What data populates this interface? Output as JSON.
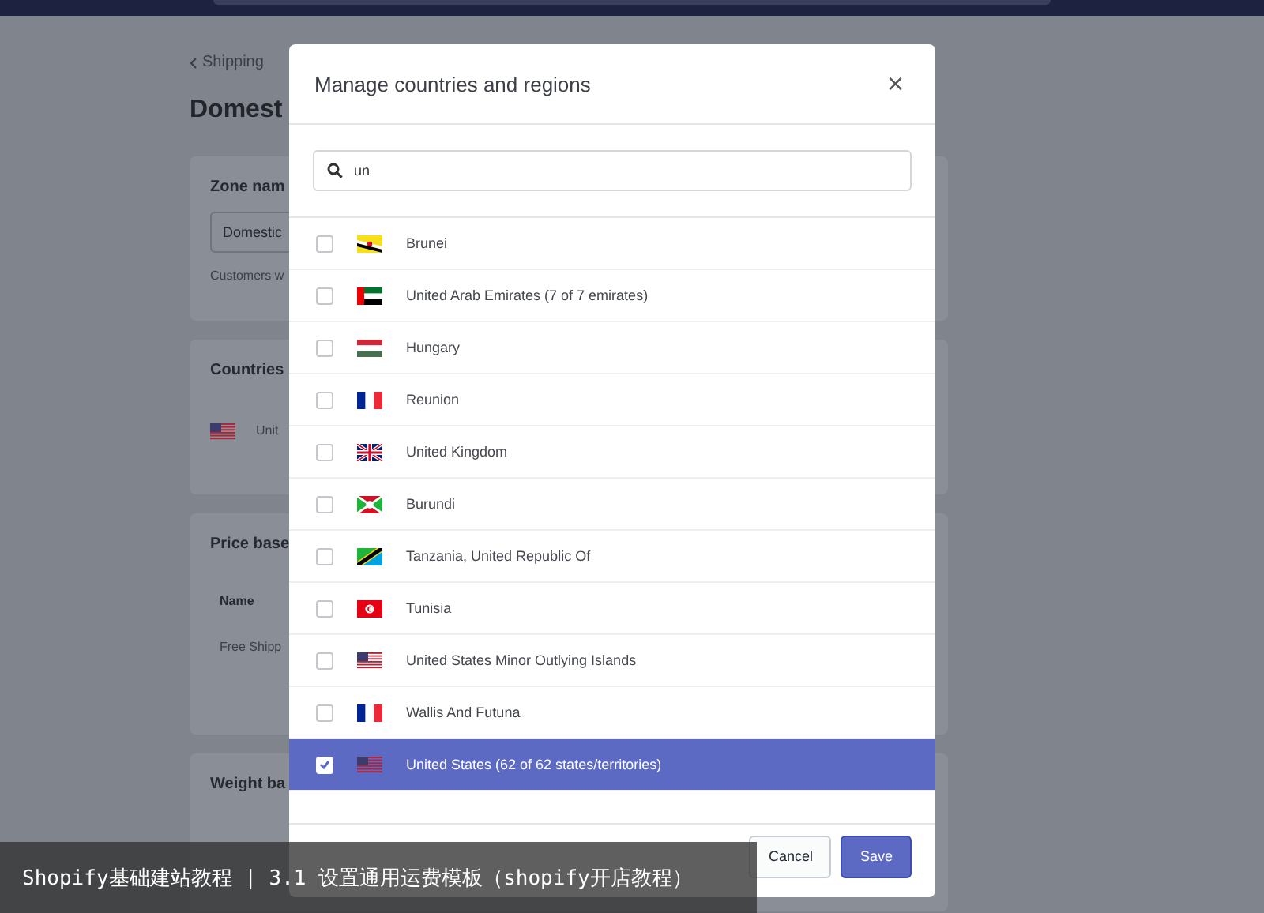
{
  "background_page": {
    "breadcrumb": "Shipping",
    "title": "Domest",
    "zone_card": {
      "heading": "Zone nam",
      "field_value": "Domestic",
      "help_text": "Customers w"
    },
    "countries_card": {
      "heading": "Countries",
      "country": "Unit"
    },
    "price_card": {
      "heading": "Price base",
      "column": "Name",
      "row": "Free Shipp"
    },
    "weight_card": {
      "heading": "Weight ba"
    }
  },
  "modal": {
    "title": "Manage countries and regions",
    "close": "×",
    "search": {
      "value": "un"
    },
    "countries": [
      {
        "name": "Brunei",
        "kind": "brunei",
        "checked": false,
        "selected": false
      },
      {
        "name": "United Arab Emirates (7 of 7 emirates)",
        "kind": "uae",
        "checked": false,
        "selected": false
      },
      {
        "name": "Hungary",
        "kind": "hungary",
        "checked": false,
        "selected": false
      },
      {
        "name": "Reunion",
        "kind": "france",
        "checked": false,
        "selected": false
      },
      {
        "name": "United Kingdom",
        "kind": "uk",
        "checked": false,
        "selected": false
      },
      {
        "name": "Burundi",
        "kind": "burundi",
        "checked": false,
        "selected": false
      },
      {
        "name": "Tanzania, United Republic Of",
        "kind": "tanzania",
        "checked": false,
        "selected": false
      },
      {
        "name": "Tunisia",
        "kind": "tunisia",
        "checked": false,
        "selected": false
      },
      {
        "name": "United States Minor Outlying Islands",
        "kind": "us",
        "checked": false,
        "selected": false
      },
      {
        "name": "Wallis And Futuna",
        "kind": "france",
        "checked": false,
        "selected": false
      },
      {
        "name": "United States (62 of 62 states/territories)",
        "kind": "us",
        "checked": true,
        "selected": true
      }
    ],
    "buttons": [
      {
        "label": "Cancel",
        "kind": "secondary"
      },
      {
        "label": "Save",
        "kind": "primary"
      }
    ]
  },
  "video_caption": "Shopify基础建站教程 | 3.1 设置通用运费模板（shopify开店教程）"
}
